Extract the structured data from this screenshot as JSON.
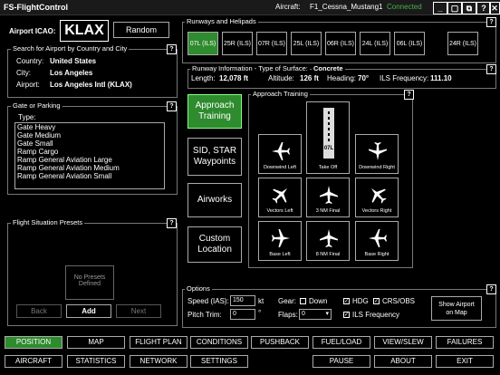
{
  "titlebar": {
    "title": "FS-FlightControl",
    "aircraft_label": "Aircraft:",
    "aircraft_name": "F1_Cessna_Mustang1",
    "status": "Connected",
    "status_color": "#4caf50",
    "buttons": [
      "_",
      "▢",
      "⧉",
      "?",
      "✕"
    ]
  },
  "airport": {
    "icao_label": "Airport ICAO:",
    "icao_value": "KLAX",
    "random_label": "Random"
  },
  "search": {
    "title": "Search for Airport by Country and City",
    "country_label": "Country:",
    "country_value": "United States",
    "city_label": "City:",
    "city_value": "Los Angeles",
    "airport_label": "Airport:",
    "airport_value": "Los Angeles Intl (KLAX)"
  },
  "gate": {
    "title": "Gate or Parking",
    "type_label": "Type:",
    "items": [
      "Gate Heavy",
      "Gate Medium",
      "Gate Small",
      "Ramp Cargo",
      "Ramp General Aviation Large",
      "Ramp General Aviation Medium",
      "Ramp General Aviation Small"
    ]
  },
  "presets": {
    "title": "Flight Situation Presets",
    "none_line1": "No Presets",
    "none_line2": "Defined",
    "back_label": "Back",
    "add_label": "Add",
    "next_label": "Next"
  },
  "runways": {
    "title": "Runways and Helipads",
    "items": [
      "07L (ILS)",
      "25R (ILS)",
      "07R (ILS)",
      "25L (ILS)",
      "06R (ILS)",
      "24L (ILS)",
      "06L (ILS)",
      "24R (ILS)"
    ],
    "selected_index": 0
  },
  "runway_info": {
    "title": "Runway Information - Type of Surface:",
    "surface": "Concrete",
    "length_label": "Length:",
    "length_value": "12,078 ft",
    "altitude_label": "Altitude:",
    "altitude_value": "126 ft",
    "heading_label": "Heading:",
    "heading_value": "70°",
    "ils_label": "ILS Frequency:",
    "ils_value": "111.10"
  },
  "modes": {
    "approach_line1": "Approach",
    "approach_line2": "Training",
    "sid_line1": "SID, STAR",
    "sid_line2": "Waypoints",
    "airworks": "Airworks",
    "custom_line1": "Custom",
    "custom_line2": "Location"
  },
  "approach_training": {
    "title": "Approach Training",
    "runway_label": "07L",
    "tiles": [
      "Downwind Left",
      "Take Off",
      "Downwind Right",
      "Vectors Left",
      "3 NM Final",
      "Vectors Right",
      "Base Left",
      "8 NM Final",
      "Base Right"
    ]
  },
  "options": {
    "title": "Options",
    "speed_label": "Speed (IAS):",
    "speed_value": "150",
    "speed_unit": "kt",
    "pitch_label": "Pitch Trim:",
    "pitch_value": "0",
    "pitch_unit": "°",
    "gear_label": "Gear:",
    "down_label": "Down",
    "flaps_label": "Flaps:",
    "flaps_value": "0",
    "hdg_label": "HDG",
    "crs_label": "CRS/OBS",
    "ils_freq_label": "ILS Frequency",
    "show_airport_line1": "Show Airport",
    "show_airport_line2": "on Map"
  },
  "nav_row1": [
    "POSITION",
    "MAP",
    "FLIGHT PLAN",
    "CONDITIONS",
    "PUSHBACK",
    "FUEL/LOAD",
    "VIEW/SLEW",
    "FAILURES"
  ],
  "nav_row2": [
    "AIRCRAFT",
    "STATISTICS",
    "NETWORK",
    "SETTINGS",
    "",
    "PAUSE",
    "ABOUT",
    "EXIT"
  ],
  "nav_active": "POSITION",
  "accent_green": "#2e8b2e"
}
